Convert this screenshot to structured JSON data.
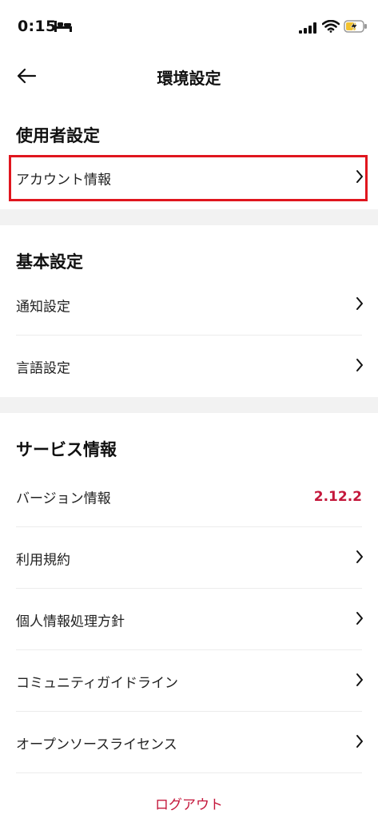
{
  "status_bar": {
    "time": "0:15"
  },
  "header": {
    "title": "環境設定"
  },
  "sections": {
    "user": {
      "title": "使用者設定",
      "items": [
        {
          "label": "アカウント情報"
        }
      ]
    },
    "basic": {
      "title": "基本設定",
      "items": [
        {
          "label": "通知設定"
        },
        {
          "label": "言語設定"
        }
      ]
    },
    "service": {
      "title": "サービス情報",
      "version": {
        "label": "バージョン情報",
        "value": "2.12.2"
      },
      "items": [
        {
          "label": "利用規約"
        },
        {
          "label": "個人情報処理方針"
        },
        {
          "label": "コミュニティガイドライン"
        },
        {
          "label": "オープンソースライセンス"
        }
      ]
    }
  },
  "logout_label": "ログアウト",
  "colors": {
    "accent": "#c4173b",
    "highlight": "#e0161e",
    "gap": "#f2f2f2"
  }
}
